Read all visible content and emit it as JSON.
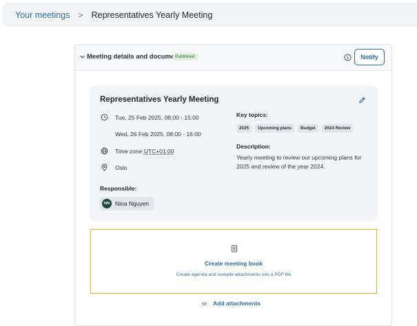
{
  "breadcrumb": {
    "parent": "Your meetings",
    "separator": ">",
    "current": "Representatives Yearly Meeting"
  },
  "panel": {
    "title": "Meeting details and documents",
    "status_badge": "Published",
    "notify_label": "Notify"
  },
  "meeting": {
    "title": "Representatives Yearly Meeting",
    "dates": [
      "Tue, 25 Feb 2025, 08:00 - 15:00",
      "Wed, 26 Feb 2025, 08:00 - 16:00"
    ],
    "timezone_label": "Time zone",
    "timezone_value": "UTC+01:00",
    "location": "Oslo",
    "responsible_label": "Responsible:",
    "responsible": {
      "initials": "NN",
      "name": "Nina Nguyen"
    },
    "key_topics_label": "Key topics:",
    "key_topics": [
      "2025",
      "Upcoming plans",
      "Budget",
      "2024 Review"
    ],
    "description_label": "Description:",
    "description": "Yearly meeting to review our upcoming plans for 2025 and review of the year 2024."
  },
  "meeting_book": {
    "title": "Create meeting book",
    "subtitle": "Create agenda and compile attachments into a PDF file"
  },
  "attachments": {
    "or_text": "or",
    "link_label": "Add attachments"
  },
  "colors": {
    "accent": "#2f6b9a",
    "highlight": "#f0b02a",
    "badge_bg": "#def1dc",
    "avatar_bg": "#1e4a3c"
  },
  "icons": [
    "chevron-right-icon",
    "chevron-down-icon",
    "info-icon",
    "pencil-icon",
    "clock-icon",
    "globe-icon",
    "location-pin-icon",
    "book-icon"
  ]
}
